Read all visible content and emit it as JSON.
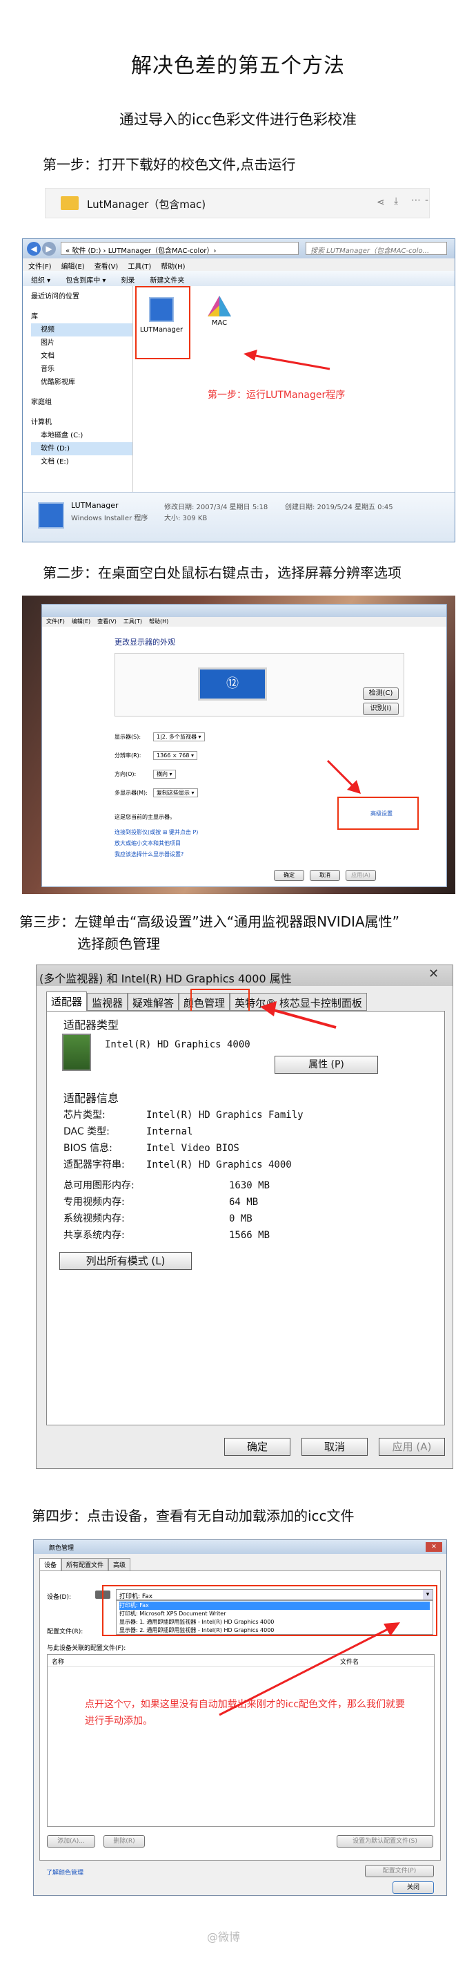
{
  "title": "解决色差的第五个方法",
  "subtitle": "通过导入的icc色彩文件进行色彩校准",
  "steps": {
    "s1": "第一步：打开下载好的校色文件,点击运行",
    "s2": "第二步：在桌面空白处鼠标右键点击，选择屏幕分辨率选项",
    "s3a": "第三步：左键单击“高级设置”进入“通用监视器跟NVIDIA属性”",
    "s3b": "选择颜色管理",
    "s4": "第四步：点击设备，查看有无自动加载添加的icc文件"
  },
  "filebar": {
    "name": "LutManager（包含mac)"
  },
  "explorer": {
    "path": "« 软件 (D:) › LUTManager（包含MAC-color）›",
    "search": "搜索 LUTManager（包含MAC-colo...",
    "menus": [
      "文件(F)",
      "编辑(E)",
      "查看(V)",
      "工具(T)",
      "帮助(H)"
    ],
    "toolbar": [
      "组织 ▾",
      "包含到库中 ▾",
      "刻录",
      "新建文件夹"
    ],
    "nav": [
      "最近访问的位置",
      "库",
      "视频",
      "图片",
      "文档",
      "音乐",
      "优酷影视库",
      "家庭组",
      "计算机",
      "本地磁盘 (C:)",
      "软件 (D:)",
      "文档 (E:)"
    ],
    "file1": "LUTManager",
    "file2": "MAC",
    "annotation": "第一步：运行LUTManager程序",
    "detail_name": "LUTManager",
    "detail_type": "Windows Installer 程序",
    "detail_mod": "修改日期: 2007/3/4 星期日 5:18",
    "detail_created": "创建日期: 2019/5/24 星期五 0:45",
    "detail_size": "大小: 309 KB"
  },
  "display": {
    "menus": [
      "文件(F)",
      "编辑(E)",
      "查看(V)",
      "工具(T)",
      "帮助(H)"
    ],
    "heading": "更改显示器的外观",
    "btn_detect": "检测(C)",
    "btn_identify": "识别(I)",
    "rows": [
      {
        "label": "显示器(S):",
        "value": "1|2. 多个监视器 ▾"
      },
      {
        "label": "分辨率(R):",
        "value": "1366 × 768 ▾"
      },
      {
        "label": "方向(O):",
        "value": "横向 ▾"
      },
      {
        "label": "多显示器(M):",
        "value": "复制这些显示 ▾"
      }
    ],
    "note": "这是您当前的主显示器。",
    "advanced": "高级设置",
    "links": [
      "连接到投影仪(或按 ⊞ 键并点击 P)",
      "放大或缩小文本和其他项目",
      "我应该选择什么显示器设置?"
    ],
    "ok": "确定",
    "cancel": "取消",
    "apply": "应用(A)"
  },
  "adapter": {
    "title": "(多个监视器) 和 Intel(R) HD Graphics 4000 属性",
    "tabs": [
      "适配器",
      "监视器",
      "疑难解答",
      "颜色管理",
      "英特尔® 核芯显卡控制面板"
    ],
    "type_heading": "适配器类型",
    "adapter_name": "Intel(R) HD Graphics 4000",
    "properties": "属性 (P)",
    "info_heading": "适配器信息",
    "info": [
      {
        "k": "芯片类型:",
        "v": "Intel(R) HD Graphics Family"
      },
      {
        "k": "DAC 类型:",
        "v": "Internal"
      },
      {
        "k": "BIOS 信息:",
        "v": "Intel Video BIOS"
      },
      {
        "k": "适配器字符串:",
        "v": "Intel(R) HD Graphics 4000"
      }
    ],
    "mem": [
      {
        "k": "总可用图形内存:",
        "v": "1630 MB"
      },
      {
        "k": "专用视频内存:",
        "v": "64 MB"
      },
      {
        "k": "系统视频内存:",
        "v": "0 MB"
      },
      {
        "k": "共享系统内存:",
        "v": "1566 MB"
      }
    ],
    "list_modes": "列出所有模式 (L)",
    "ok": "确定",
    "cancel": "取消",
    "apply": "应用 (A)"
  },
  "colormgmt": {
    "title": "颜色管理",
    "tabs": [
      "设备",
      "所有配置文件",
      "高级"
    ],
    "device_label": "设备(D):",
    "device_value": "打印机: Fax",
    "options": [
      "打印机: Fax",
      "打印机: Microsoft XPS Document Writer",
      "显示器: 1. 通用即插即用监视器 - Intel(R) HD Graphics 4000",
      "显示器: 2. 通用即插即用监视器 - Intel(R) HD Graphics 4000"
    ],
    "profile_label": "配置文件(R):",
    "assoc_label": "与此设备关联的配置文件(F):",
    "col_name": "名称",
    "col_file": "文件名",
    "annotation": "点开这个▽，如果这里没有自动加载出来刚才的icc配色文件，那么我们就要进行手动添加。",
    "add": "添加(A)...",
    "remove": "删除(R)",
    "default": "设置为默认配置文件(S)",
    "link": "了解颜色管理",
    "profiles_btn": "配置文件(P)",
    "close": "关闭"
  },
  "watermark": "@微博"
}
